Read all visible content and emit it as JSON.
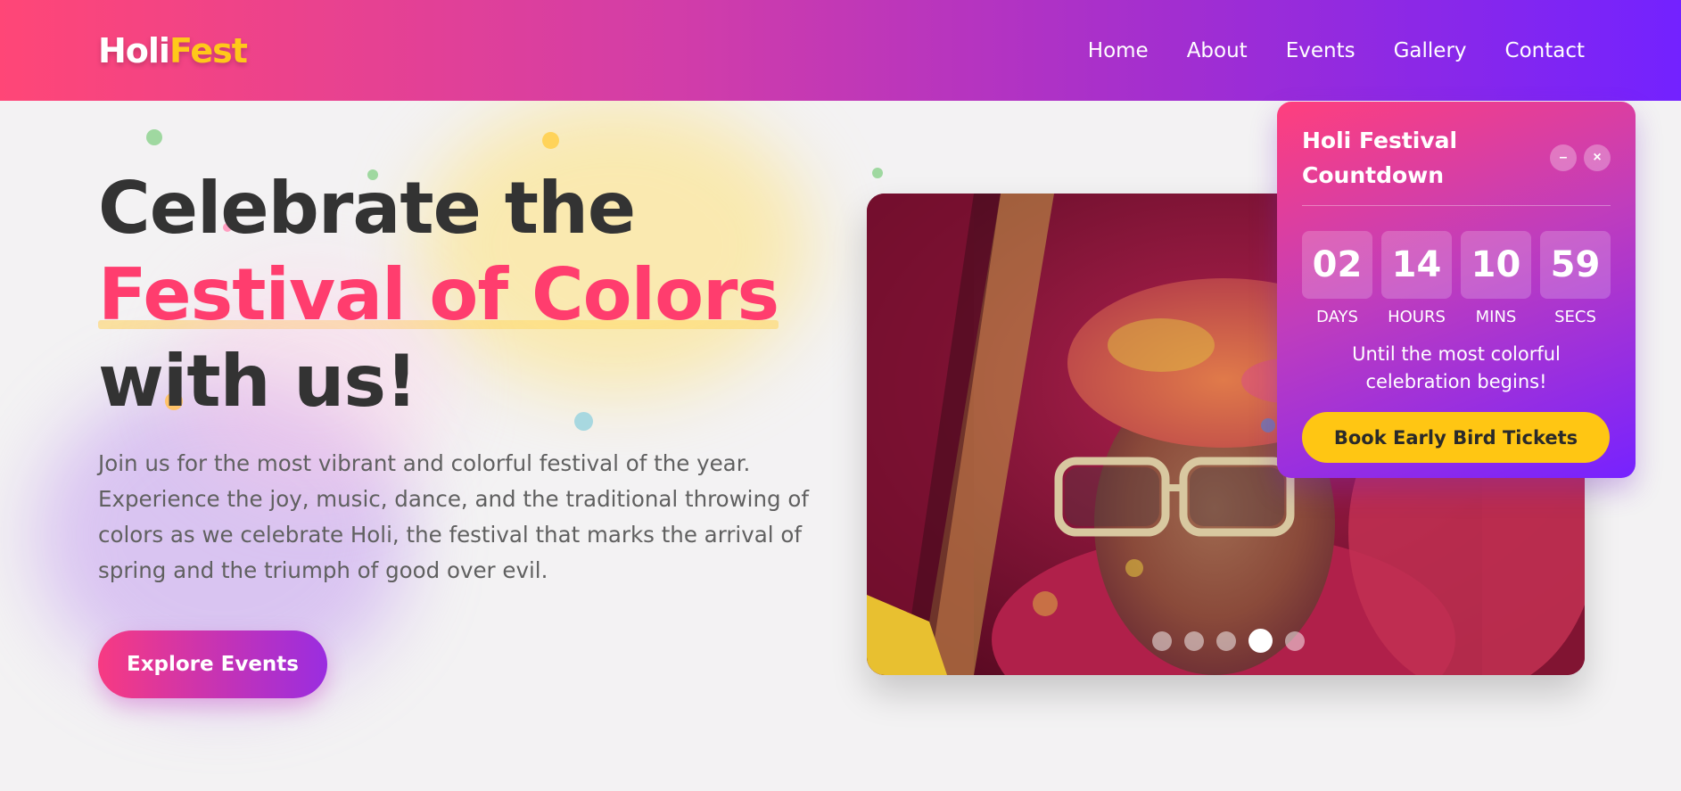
{
  "logo": {
    "part1": "Holi",
    "part2": "Fest"
  },
  "nav": [
    "Home",
    "About",
    "Events",
    "Gallery",
    "Contact"
  ],
  "hero": {
    "title_line1": "Celebrate the",
    "title_accent": "Festival of Colors",
    "title_line3": "with us!",
    "description": "Join us for the most vibrant and colorful festival of the year. Experience the joy, music, dance, and the traditional throwing of colors as we celebrate Holi, the festival that marks the arrival of spring and the triumph of good over evil.",
    "cta": "Explore Events"
  },
  "slider": {
    "slide_count": 5,
    "active_index": 3
  },
  "countdown": {
    "title": "Holi Festival Countdown",
    "minimize_icon": "minus-icon",
    "close_icon": "close-icon",
    "minimize_symbol": "–",
    "close_symbol": "×",
    "units": [
      {
        "value": "02",
        "label": "DAYS"
      },
      {
        "value": "14",
        "label": "HOURS"
      },
      {
        "value": "10",
        "label": "MINS"
      },
      {
        "value": "59",
        "label": "SECS"
      }
    ],
    "subtitle": "Until the most colorful celebration begins!",
    "cta": "Book Early Bird Tickets"
  },
  "colors": {
    "brand_pink": "#ff3d6e",
    "brand_purple": "#7322ff",
    "brand_yellow": "#ffc81a",
    "text_dark": "#333333"
  }
}
